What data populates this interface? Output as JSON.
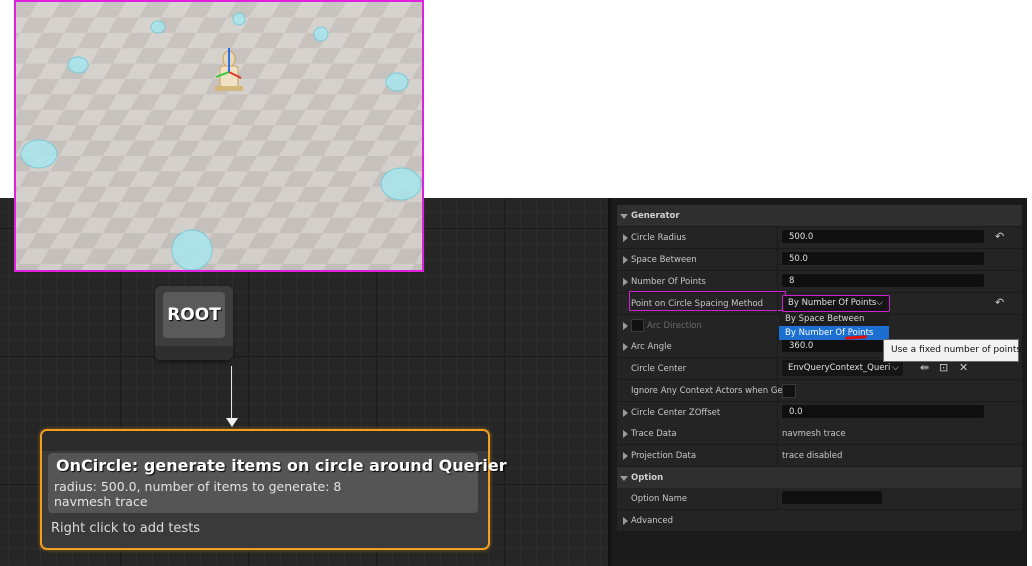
{
  "graph": {
    "root_node": {
      "label": "ROOT"
    },
    "generator_node": {
      "title": "OnCircle: generate items on circle around Querier",
      "description_line1": "radius: 500.0, number of items to generate: 8",
      "description_line2": "navmesh trace",
      "footer": "Right click to add tests"
    }
  },
  "details": {
    "generator_header": "Generator",
    "circle_radius": {
      "label": "Circle Radius",
      "value": "500.0"
    },
    "space_between": {
      "label": "Space Between",
      "value": "50.0"
    },
    "number_of_points": {
      "label": "Number Of Points",
      "value": "8"
    },
    "spacing_method": {
      "label": "Point on Circle Spacing Method",
      "value": "By Number Of Points"
    },
    "spacing_options": [
      "By Space Between",
      "By Number Of Points"
    ],
    "arc_direction": {
      "label": "Arc Direction"
    },
    "arc_angle": {
      "label": "Arc Angle",
      "value": "360.0"
    },
    "circle_center": {
      "label": "Circle Center",
      "value": "EnvQueryContext_Querier"
    },
    "ignore_context": {
      "label": "Ignore Any Context Actors when Ge..."
    },
    "circle_center_zoffset": {
      "label": "Circle Center ZOffset",
      "value": "0.0"
    },
    "trace_data": {
      "label": "Trace Data",
      "value": "navmesh trace"
    },
    "projection_data": {
      "label": "Projection Data",
      "value": "trace disabled"
    },
    "option_header": "Option",
    "option_name": {
      "label": "Option Name",
      "value": ""
    },
    "advanced_header": "Advanced",
    "tooltip": "Use a fixed number of points"
  },
  "colors": {
    "highlight_border": "#d020d0",
    "selected_node_border": "#f0a020",
    "menu_selection": "#1a6fd0"
  }
}
